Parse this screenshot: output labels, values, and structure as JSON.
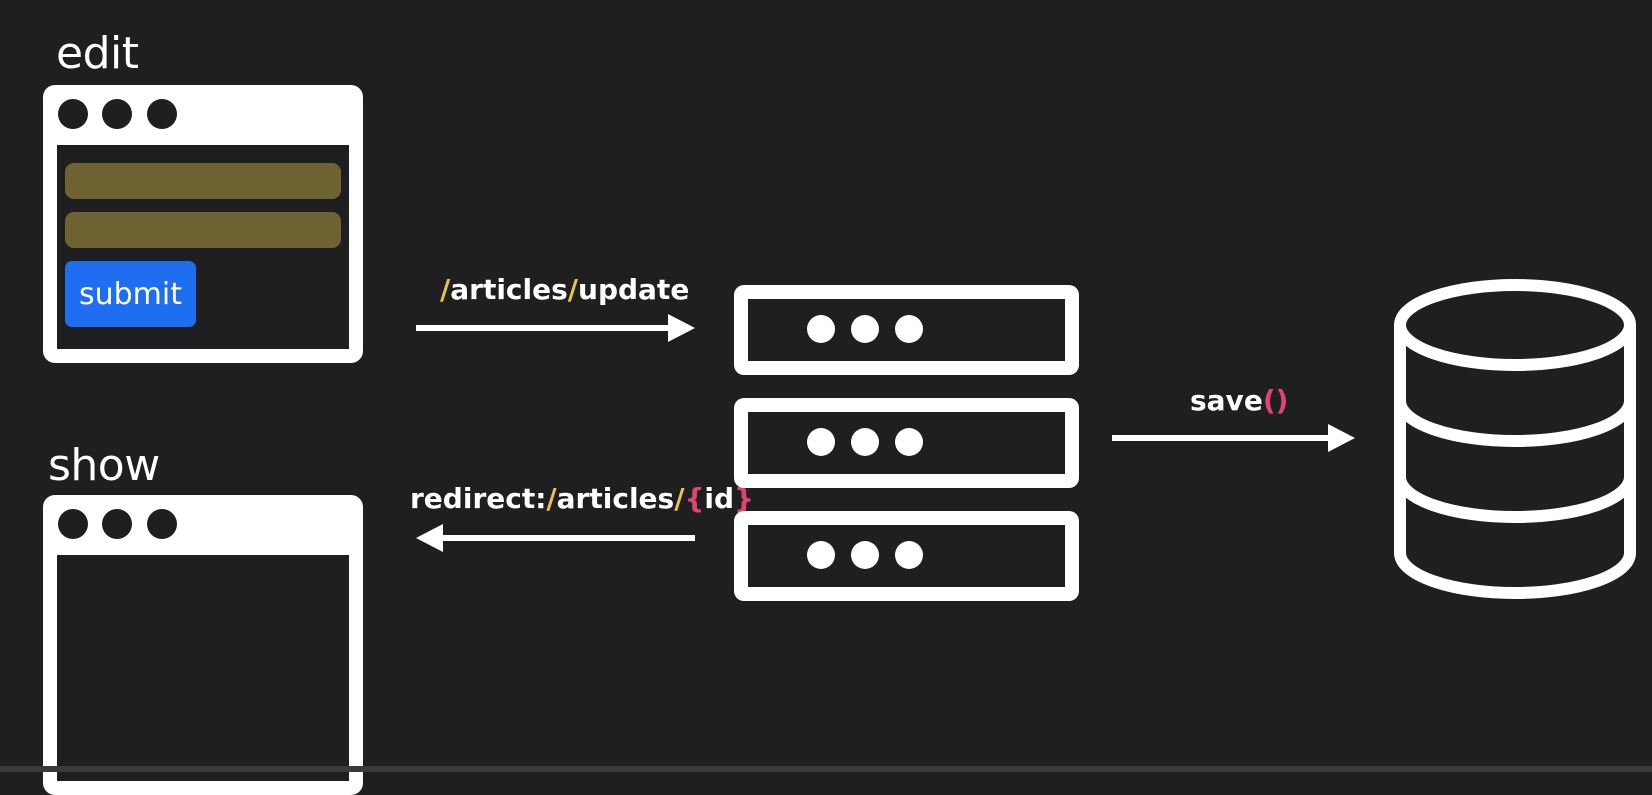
{
  "colors": {
    "background": "#1f1f22",
    "stroke": "#ffffff",
    "form_field": "#6f6334",
    "submit_button": "#1f6ef0",
    "path_slash": "#e6c64a",
    "bracket": "#e0456f"
  },
  "edit": {
    "title": "edit",
    "submit_label": "submit"
  },
  "show": {
    "title": "show"
  },
  "request": {
    "slash1": "/",
    "seg1": "articles",
    "slash2": "/",
    "seg2": "update"
  },
  "response": {
    "prefix": "redirect:",
    "slash1": "/",
    "seg1": "articles",
    "slash2": "/",
    "brace_open": "{",
    "param": "id",
    "brace_close": "}"
  },
  "save": {
    "name": "save",
    "parens": "()"
  },
  "icons": {
    "server": "server-stack-icon",
    "database": "database-cylinder-icon",
    "browser": "browser-window-icon"
  }
}
